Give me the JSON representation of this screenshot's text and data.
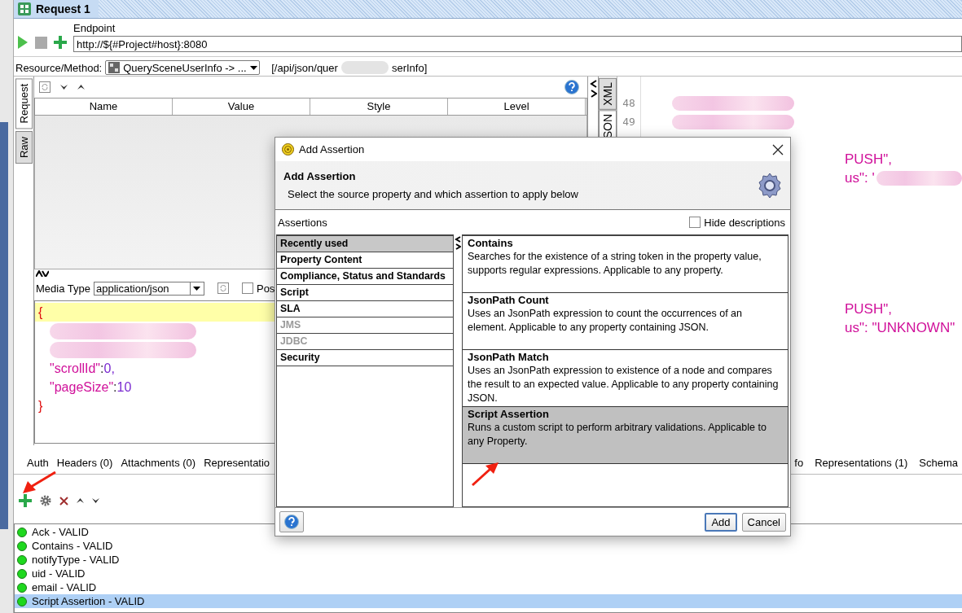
{
  "tab": {
    "title": "Request 1",
    "selected": true
  },
  "endpoint": {
    "label": "Endpoint",
    "value": "http://${#Project#host}:8080"
  },
  "resource": {
    "label": "Resource/Method:",
    "value": "QuerySceneUserInfo -> ...",
    "path_start": "[/api/json/quer",
    "path_end": "serInfo]"
  },
  "request_panel": {
    "side_tabs": [
      {
        "label": "Request",
        "selected": true
      },
      {
        "label": "Raw",
        "selected": false
      }
    ],
    "columns": [
      "Name",
      "Value",
      "Style",
      "Level"
    ],
    "media_type_label": "Media Type",
    "media_type": "application/json",
    "post": {
      "label": "Pos",
      "checked": false
    },
    "code_lines": [
      {
        "highlighted": true,
        "tokens": [
          {
            "text": "{",
            "kind": "brace"
          }
        ]
      },
      {
        "highlighted": false,
        "blurred": true
      },
      {
        "highlighted": false,
        "blurred": true
      },
      {
        "highlighted": false,
        "tokens": [
          {
            "text": "\"scrollId\"",
            "kind": "key"
          },
          {
            "text": ":",
            "kind": "plain"
          },
          {
            "text": "0,",
            "kind": "number"
          }
        ]
      },
      {
        "highlighted": false,
        "tokens": [
          {
            "text": "\"pageSize\"",
            "kind": "key"
          },
          {
            "text": ":",
            "kind": "plain"
          },
          {
            "text": "10",
            "kind": "number"
          }
        ]
      },
      {
        "highlighted": false,
        "tokens": [
          {
            "text": "}",
            "kind": "brace"
          }
        ]
      }
    ]
  },
  "response_panel": {
    "side_tabs": [
      {
        "label": "XML",
        "selected": false
      },
      {
        "label": "SON",
        "selected": true
      }
    ],
    "blocks": [
      [
        {
          "number": "48",
          "blurred": true
        },
        {
          "number": "49",
          "blurred": true
        }
      ],
      [
        {
          "text": "PUSH\","
        },
        {
          "text": "us\": '",
          "blurred": true
        }
      ],
      [
        {
          "text": "PUSH\","
        },
        {
          "text": "us\": \"UNKNOWN\""
        }
      ]
    ]
  },
  "bottom_tabs": {
    "left": [
      "Auth",
      "Headers (0)",
      "Attachments (0)",
      "Representatio"
    ],
    "right": [
      "fo",
      "Representations (1)",
      "Schema"
    ]
  },
  "assertions": [
    {
      "label": "Ack - VALID",
      "selected": false
    },
    {
      "label": "Contains - VALID",
      "selected": false
    },
    {
      "label": "notifyType - VALID",
      "selected": false
    },
    {
      "label": "uid - VALID",
      "selected": false
    },
    {
      "label": "email - VALID",
      "selected": false
    },
    {
      "label": "Script Assertion - VALID",
      "selected": true
    }
  ],
  "dialog": {
    "title": "Add Assertion",
    "heading": "Add Assertion",
    "subtitle": "Select the source property and which assertion to apply below",
    "list_label": "Assertions",
    "hide_descriptions": {
      "label": "Hide descriptions",
      "checked": false
    },
    "categories": [
      {
        "label": "Recently used",
        "selected": true,
        "disabled": false
      },
      {
        "label": "Property Content",
        "selected": false,
        "disabled": false
      },
      {
        "label": "Compliance, Status and Standards",
        "selected": false,
        "disabled": false
      },
      {
        "label": "Script",
        "selected": false,
        "disabled": false
      },
      {
        "label": "SLA",
        "selected": false,
        "disabled": false
      },
      {
        "label": "JMS",
        "selected": false,
        "disabled": true
      },
      {
        "label": "JDBC",
        "selected": false,
        "disabled": true
      },
      {
        "label": "Security",
        "selected": false,
        "disabled": false
      }
    ],
    "options": [
      {
        "title": "Contains",
        "description": "Searches for the existence of a string token in the property value, supports regular expressions. Applicable to any property.",
        "selected": false
      },
      {
        "title": "JsonPath Count",
        "description": "Uses an JsonPath expression to count the occurrences of an element. Applicable to any property containing JSON.",
        "selected": false
      },
      {
        "title": "JsonPath Match",
        "description": "Uses an JsonPath expression to existence of a node and compares the result to an expected value. Applicable to any property containing JSON.",
        "selected": false
      },
      {
        "title": "Script Assertion",
        "description": "Runs a custom script to perform arbitrary validations. Applicable to any Property.",
        "selected": true
      }
    ],
    "buttons": [
      {
        "label": "Add",
        "default": true
      },
      {
        "label": "Cancel",
        "default": false
      }
    ]
  }
}
